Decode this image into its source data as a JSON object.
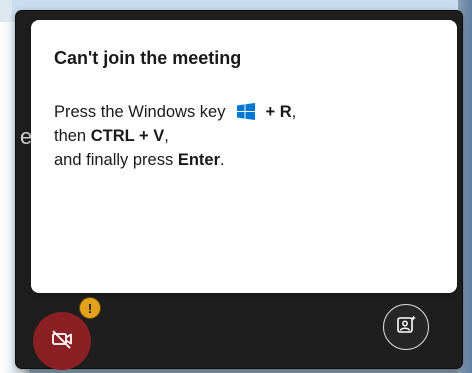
{
  "dialog": {
    "title": "Can't join the meeting",
    "line1_before": "Press the Windows key",
    "line1_after_bold": "+ R",
    "line1_end": ",",
    "line2_before": "then ",
    "line2_bold": "CTRL + V",
    "line2_end": ",",
    "line3_before": "and finally press ",
    "line3_bold": "Enter",
    "line3_end": "."
  },
  "background_glyph": "e",
  "badge": {
    "symbol": "!"
  },
  "icons": {
    "windows": "windows-logo-icon",
    "camera_off": "video-off-icon",
    "effects": "background-effects-icon",
    "warning": "warning-icon"
  },
  "colors": {
    "panel": "#1e1e1e",
    "video_off_button": "#8a1f24",
    "warning_badge": "#e3a21a",
    "windows_blue": "#0078d4"
  }
}
